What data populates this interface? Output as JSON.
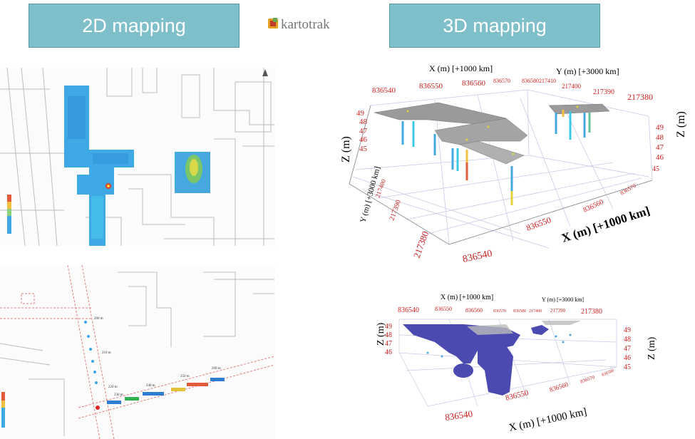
{
  "header": {
    "left_button": "2D mapping",
    "right_button": "3D mapping",
    "logo_text": "kartotrak"
  },
  "top_3d": {
    "x_title": "X (m) [+1000 km]",
    "y_title": "Y (m) [+3000 km]",
    "x_ticks_top": [
      "836540",
      "836550",
      "836560",
      "836570",
      "836580"
    ],
    "y_ticks_top": [
      "217410",
      "217400",
      "217390",
      "217380"
    ],
    "z_title": "Z (m)",
    "z_ticks": [
      "49",
      "48",
      "47",
      "46",
      "45"
    ],
    "y_left_title": "Y (m) [+3000 km]",
    "y_left_ticks": [
      "217400",
      "217390",
      "217380"
    ],
    "x_bottom_title": "X (m) [+1000 km]",
    "x_bottom_ticks": [
      "836540",
      "836550",
      "836560",
      "836570"
    ]
  },
  "bottom_3d": {
    "x_title": "X (m) [+1000 km]",
    "y_title": "Y (m) [+3000 km]",
    "x_ticks_top": [
      "836540",
      "836550",
      "836560",
      "836570",
      "836580",
      "217400",
      "217390",
      "217380"
    ],
    "z_title": "Z (m)",
    "z_ticks": [
      "49",
      "48",
      "47",
      "46",
      "45"
    ],
    "x_bottom_title": "X (m) [+1000 km]",
    "x_bottom_ticks": [
      "836540",
      "836550",
      "836560",
      "836570",
      "836580"
    ]
  },
  "map2d_bottom": {
    "labels": [
      "200 m",
      "210 m",
      "220 m",
      "230 m",
      "240 m",
      "250 m",
      "260 m"
    ]
  },
  "colors": {
    "button_bg": "#7ebfc9",
    "tick_red": "#cc1f1f",
    "map_blue": "#3fa9e6",
    "body_blue": "#4a4ab0"
  }
}
